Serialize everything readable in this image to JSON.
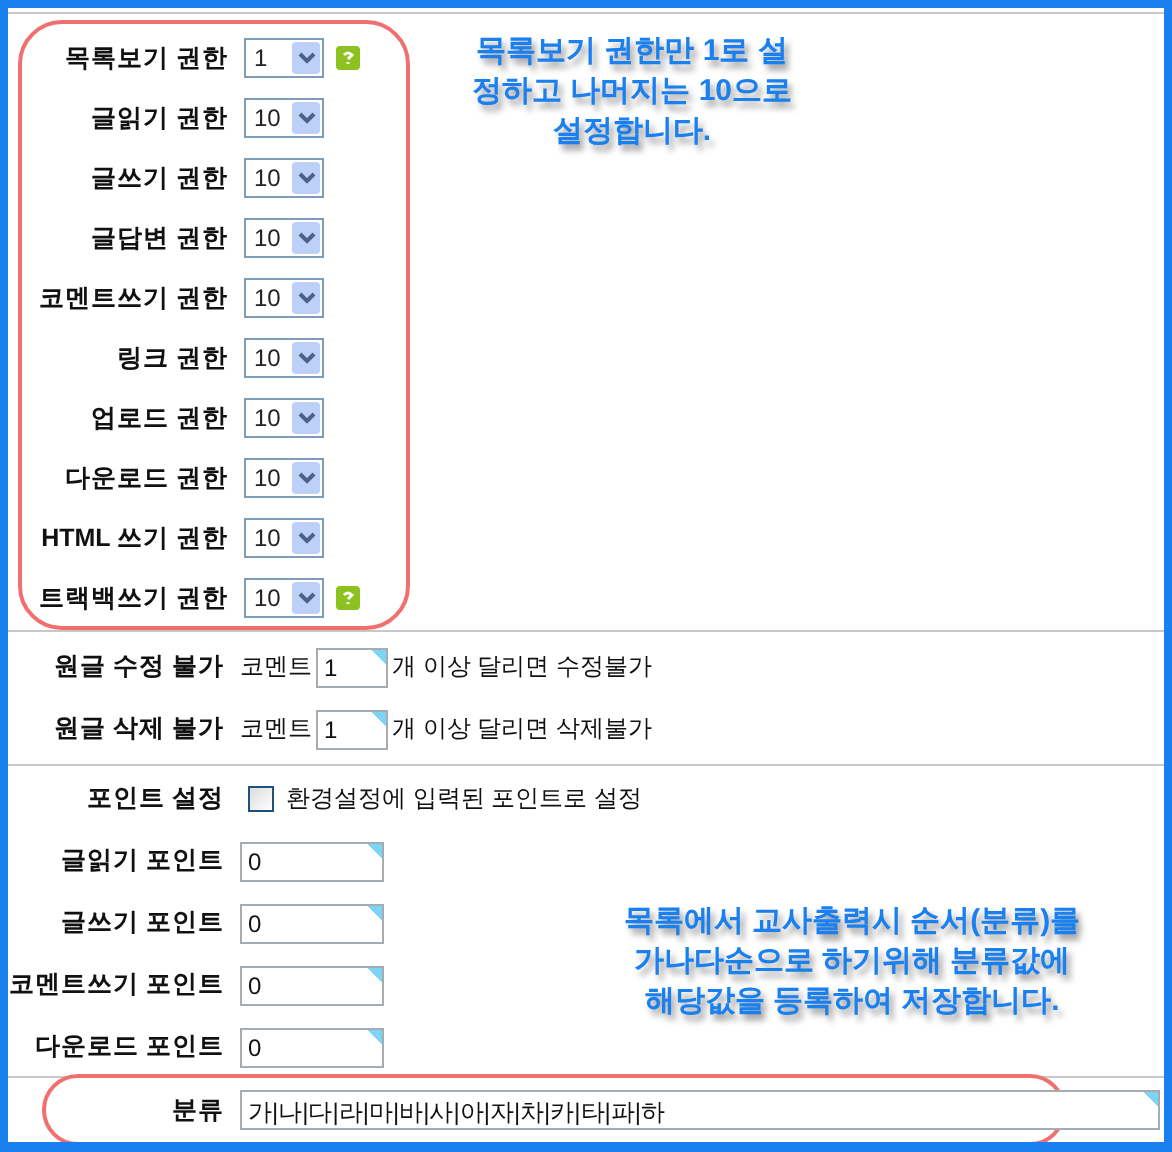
{
  "permissions": [
    {
      "label": "목록보기 권한",
      "value": "1",
      "help": true
    },
    {
      "label": "글읽기 권한",
      "value": "10",
      "help": false
    },
    {
      "label": "글쓰기 권한",
      "value": "10",
      "help": false
    },
    {
      "label": "글답변 권한",
      "value": "10",
      "help": false
    },
    {
      "label": "코멘트쓰기 권한",
      "value": "10",
      "help": false
    },
    {
      "label": "링크 권한",
      "value": "10",
      "help": false
    },
    {
      "label": "업로드 권한",
      "value": "10",
      "help": false
    },
    {
      "label": "다운로드 권한",
      "value": "10",
      "help": false
    },
    {
      "label": "HTML 쓰기 권한",
      "value": "10",
      "help": false
    },
    {
      "label": "트랙백쓰기 권한",
      "value": "10",
      "help": true
    }
  ],
  "note_top": [
    "목록보기 권한만 1로 설",
    "정하고 나머지는 10으로",
    "설정합니다."
  ],
  "comment_limits": [
    {
      "label": "원글 수정 불가",
      "prefix": "코멘트",
      "value": "1",
      "suffix": "개 이상 달리면 수정불가"
    },
    {
      "label": "원글 삭제 불가",
      "prefix": "코멘트",
      "value": "1",
      "suffix": "개 이상 달리면 삭제불가"
    }
  ],
  "point_setting": {
    "label": "포인트 설정",
    "checked": false,
    "text": "환경설정에 입력된 포인트로 설정"
  },
  "points": [
    {
      "label": "글읽기 포인트",
      "value": "0"
    },
    {
      "label": "글쓰기 포인트",
      "value": "0"
    },
    {
      "label": "코멘트쓰기 포인트",
      "value": "0"
    },
    {
      "label": "다운로드 포인트",
      "value": "0"
    }
  ],
  "note_bottom": [
    "목록에서 교사출력시 순서(분류)를",
    "가나다순으로 하기위해 분류값에",
    "해당값을 등록하여 저장합니다."
  ],
  "category": {
    "label": "분류",
    "value": "가|나|다|라|마|바|사|아|자|차|카|타|파|하"
  }
}
